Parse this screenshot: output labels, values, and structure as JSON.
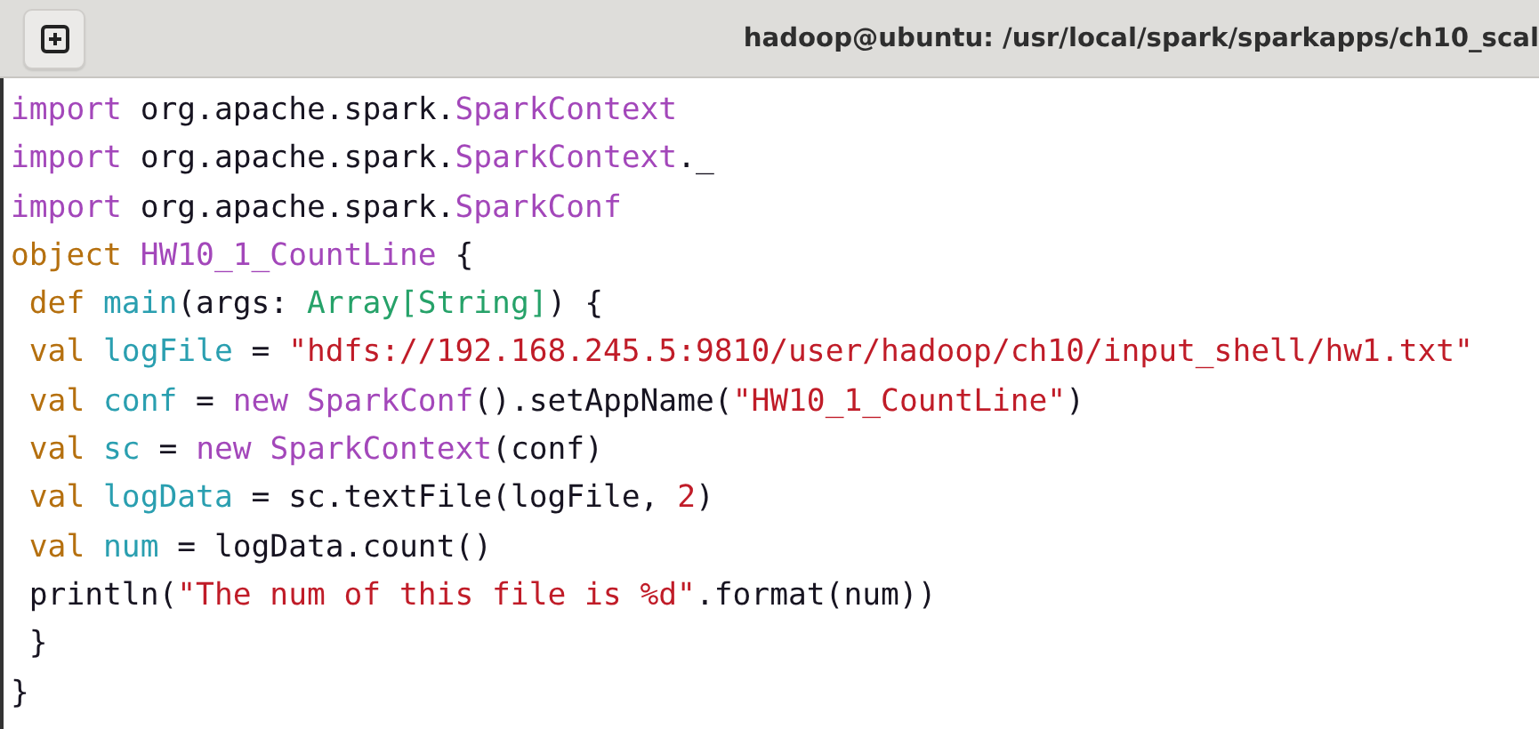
{
  "window": {
    "title": "hadoop@ubuntu: /usr/local/spark/sparkapps/ch10_scal"
  },
  "code_lines": [
    [
      {
        "kind": "kw1",
        "text": "import"
      },
      {
        "kind": "plain",
        "text": " org.apache.spark."
      },
      {
        "kind": "cls",
        "text": "SparkContext"
      }
    ],
    [
      {
        "kind": "kw1",
        "text": "import"
      },
      {
        "kind": "plain",
        "text": " org.apache.spark."
      },
      {
        "kind": "cls",
        "text": "SparkContext"
      },
      {
        "kind": "plain",
        "text": "._"
      }
    ],
    [
      {
        "kind": "kw1",
        "text": "import"
      },
      {
        "kind": "plain",
        "text": " org.apache.spark."
      },
      {
        "kind": "cls",
        "text": "SparkConf"
      }
    ],
    [
      {
        "kind": "kw2",
        "text": "object "
      },
      {
        "kind": "cls",
        "text": "HW10_1_CountLine"
      },
      {
        "kind": "plain",
        "text": " {"
      }
    ],
    [
      {
        "kind": "kw2",
        "text": " def "
      },
      {
        "kind": "ident",
        "text": "main"
      },
      {
        "kind": "plain",
        "text": "(args: "
      },
      {
        "kind": "gen",
        "text": "Array[String]"
      },
      {
        "kind": "plain",
        "text": ") {"
      }
    ],
    [
      {
        "kind": "kw2",
        "text": " val "
      },
      {
        "kind": "ident",
        "text": "logFile"
      },
      {
        "kind": "plain",
        "text": " = "
      },
      {
        "kind": "str",
        "text": "\"hdfs://192.168.245.5:9810/user/hadoop/ch10/input_shell/hw1.txt\""
      }
    ],
    [
      {
        "kind": "kw2",
        "text": " val "
      },
      {
        "kind": "ident",
        "text": "conf"
      },
      {
        "kind": "plain",
        "text": " = "
      },
      {
        "kind": "kw1",
        "text": "new "
      },
      {
        "kind": "cls",
        "text": "SparkConf"
      },
      {
        "kind": "plain",
        "text": "().setAppName("
      },
      {
        "kind": "str",
        "text": "\"HW10_1_CountLine\""
      },
      {
        "kind": "plain",
        "text": ")"
      }
    ],
    [
      {
        "kind": "kw2",
        "text": " val "
      },
      {
        "kind": "ident",
        "text": "sc"
      },
      {
        "kind": "plain",
        "text": " = "
      },
      {
        "kind": "kw1",
        "text": "new "
      },
      {
        "kind": "cls",
        "text": "SparkContext"
      },
      {
        "kind": "plain",
        "text": "(conf)"
      }
    ],
    [
      {
        "kind": "kw2",
        "text": " val "
      },
      {
        "kind": "ident",
        "text": "logData"
      },
      {
        "kind": "plain",
        "text": " = sc.textFile(logFile, "
      },
      {
        "kind": "num",
        "text": "2"
      },
      {
        "kind": "plain",
        "text": ")"
      }
    ],
    [
      {
        "kind": "kw2",
        "text": " val "
      },
      {
        "kind": "ident",
        "text": "num"
      },
      {
        "kind": "plain",
        "text": " = logData.count()"
      }
    ],
    [
      {
        "kind": "plain",
        "text": " println("
      },
      {
        "kind": "str",
        "text": "\"The num of this file is %d\""
      },
      {
        "kind": "plain",
        "text": ".format(num))"
      }
    ],
    [
      {
        "kind": "plain",
        "text": " }"
      }
    ],
    [
      {
        "kind": "plain",
        "text": "}"
      }
    ]
  ]
}
